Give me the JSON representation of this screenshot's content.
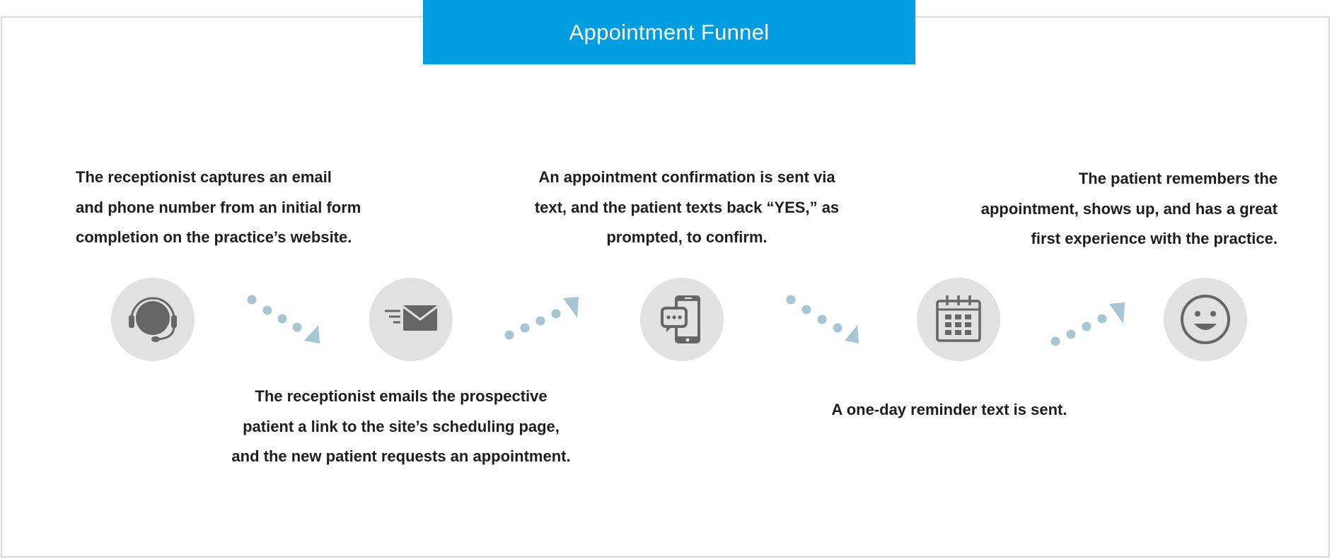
{
  "title": "Appointment Funnel",
  "steps": [
    {
      "id": "step-1",
      "icon": "headset-icon",
      "lines": [
        "The receptionist captures an email",
        "and phone number from an initial form",
        "completion on the practice’s website."
      ]
    },
    {
      "id": "step-2",
      "icon": "email-icon",
      "lines": [
        "The receptionist emails the prospective",
        "patient a link to the site’s scheduling page,",
        "and the new patient requests an appointment."
      ]
    },
    {
      "id": "step-3",
      "icon": "phone-chat-icon",
      "lines": [
        "An appointment confirmation is sent via",
        "text, and the patient texts back “YES,” as",
        "prompted, to confirm."
      ]
    },
    {
      "id": "step-4",
      "icon": "calendar-icon",
      "lines": [
        "A one-day reminder text is sent."
      ]
    },
    {
      "id": "step-5",
      "icon": "smiley-icon",
      "lines": [
        "The patient remembers the",
        "appointment, shows up, and has a great",
        "first experience with the practice."
      ]
    }
  ],
  "colors": {
    "title_bar": "#009ee0",
    "title_text": "#ffffff",
    "circle_fill": "#e1e1e1",
    "icon": "#666666",
    "arrow": "#a7c6d3",
    "frame": "#d9d9d9"
  }
}
